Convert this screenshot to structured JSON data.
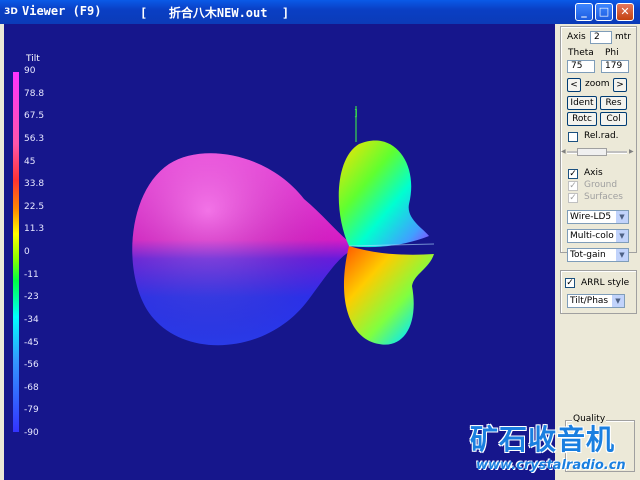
{
  "window": {
    "title": "Viewer (F9)",
    "file_title": "[   折合八木NEW.out  ]",
    "icon": "3d-icon"
  },
  "plot": {
    "colorbar_title": "Tilt",
    "ticks": [
      "90",
      "78.8",
      "67.5",
      "56.3",
      "45",
      "33.8",
      "22.5",
      "11.3",
      "0",
      "-11",
      "-23",
      "-34",
      "-45",
      "-56",
      "-68",
      "-79",
      "-90"
    ],
    "background": "#16168c"
  },
  "panel": {
    "axis_label": "Axis",
    "axis_value": "2",
    "axis_unit": "mtr",
    "theta_label": "Theta",
    "phi_label": "Phi",
    "theta_value": "75",
    "phi_value": "179",
    "zoom_left": "<",
    "zoom_label": "zoom",
    "zoom_right": ">",
    "ident_label": "Ident",
    "res_label": "Res",
    "rotc_label": "Rotc",
    "col_label": "Col",
    "relrad_label": "Rel.rad.",
    "axis_check_label": "Axis",
    "ground_label": "Ground",
    "surfaces_label": "Surfaces",
    "select_wire": "Wire-LD5",
    "select_color": "Multi-colo",
    "select_gain": "Tot-gain",
    "arrl_label": "ARRL style",
    "select_tilt": "Tilt/Phas",
    "quality_label": "Quality"
  },
  "watermark": {
    "text_cn": "矿石收音机",
    "url": "www.crystalradio.cn"
  }
}
